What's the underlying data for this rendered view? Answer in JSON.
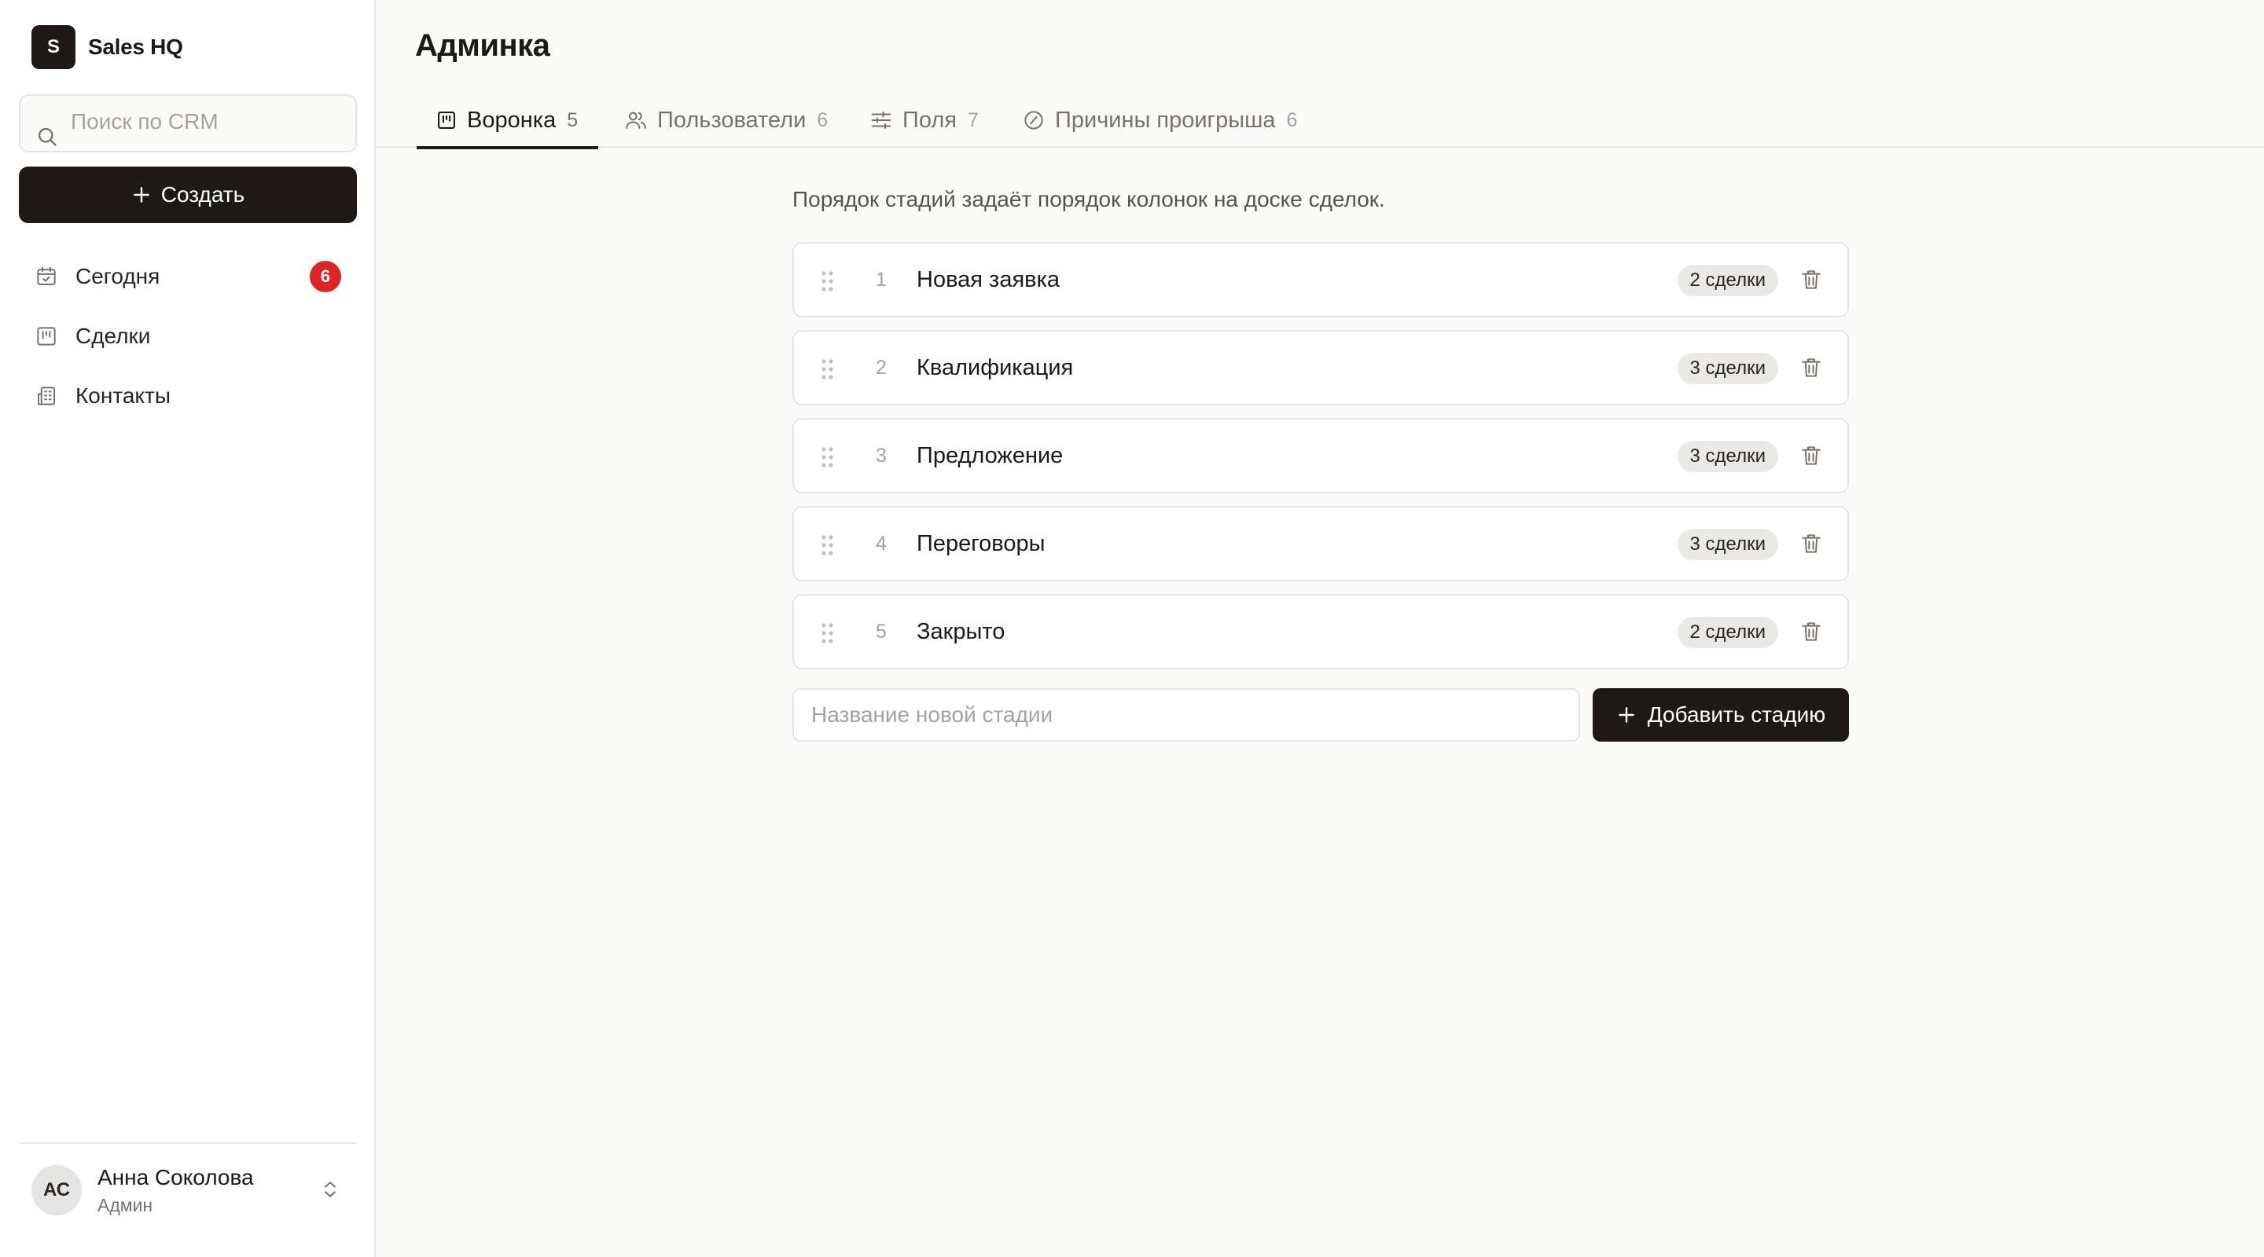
{
  "sidebar": {
    "brand": {
      "logo_letter": "S",
      "name": "Sales HQ"
    },
    "search": {
      "placeholder": "Поиск по CRM",
      "value": ""
    },
    "create_label": "Создать",
    "nav": [
      {
        "label": "Сегодня",
        "icon": "calendar-check-icon",
        "badge": "6"
      },
      {
        "label": "Сделки",
        "icon": "kanban-icon"
      },
      {
        "label": "Контакты",
        "icon": "building-icon"
      }
    ],
    "user": {
      "initials": "АС",
      "name": "Анна Соколова",
      "role": "Админ"
    }
  },
  "main": {
    "title": "Админка",
    "tabs": [
      {
        "label": "Воронка",
        "count": "5",
        "icon": "kanban-icon",
        "active": true
      },
      {
        "label": "Пользователи",
        "count": "6",
        "icon": "users-icon"
      },
      {
        "label": "Поля",
        "count": "7",
        "icon": "sliders-icon"
      },
      {
        "label": "Причины проигрыша",
        "count": "6",
        "icon": "circle-slash-icon"
      }
    ],
    "description": "Порядок стадий задаёт порядок колонок на доске сделок.",
    "stages": [
      {
        "num": "1",
        "name": "Новая заявка",
        "deals": "2 сделки"
      },
      {
        "num": "2",
        "name": "Квалификация",
        "deals": "3 сделки"
      },
      {
        "num": "3",
        "name": "Предложение",
        "deals": "3 сделки"
      },
      {
        "num": "4",
        "name": "Переговоры",
        "deals": "3 сделки"
      },
      {
        "num": "5",
        "name": "Закрыто",
        "deals": "2 сделки"
      }
    ],
    "new_stage": {
      "placeholder": "Название новой стадии",
      "value": ""
    },
    "add_label": "Добавить стадию"
  },
  "colors": {
    "accent": "#1c1917",
    "badge": "#dc2626",
    "background": "#fafaf9"
  }
}
